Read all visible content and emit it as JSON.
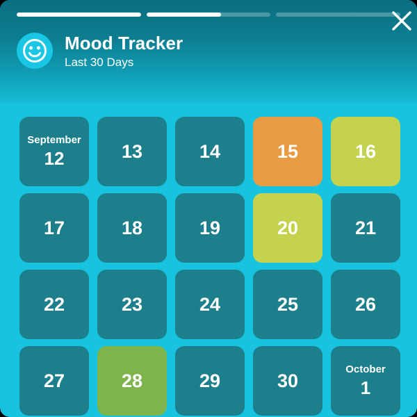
{
  "header": {
    "title": "Mood Tracker",
    "subtitle": "Last 30 Days",
    "icon": "smiley-face-icon",
    "close_icon": "close-x-icon",
    "progress": [
      {
        "label": "step-1",
        "percent": 100
      },
      {
        "label": "step-2",
        "percent": 60
      },
      {
        "label": "step-3",
        "percent": 0
      }
    ]
  },
  "colors": {
    "background": "#17C3DE",
    "header_top": "#0A6F80",
    "header_bottom": "#16BDD6",
    "cell_default": "#1E7F8C",
    "mood_orange": "#E89B42",
    "mood_yellow": "#C4D24E",
    "mood_green": "#7FB44C",
    "accent": "#19C6E4"
  },
  "calendar": {
    "days": [
      {
        "month": "September",
        "day": "12",
        "mood": "default"
      },
      {
        "month": "",
        "day": "13",
        "mood": "default"
      },
      {
        "month": "",
        "day": "14",
        "mood": "default"
      },
      {
        "month": "",
        "day": "15",
        "mood": "orange"
      },
      {
        "month": "",
        "day": "16",
        "mood": "yellow"
      },
      {
        "month": "",
        "day": "17",
        "mood": "default"
      },
      {
        "month": "",
        "day": "18",
        "mood": "default"
      },
      {
        "month": "",
        "day": "19",
        "mood": "default"
      },
      {
        "month": "",
        "day": "20",
        "mood": "yellow"
      },
      {
        "month": "",
        "day": "21",
        "mood": "default"
      },
      {
        "month": "",
        "day": "22",
        "mood": "default"
      },
      {
        "month": "",
        "day": "23",
        "mood": "default"
      },
      {
        "month": "",
        "day": "24",
        "mood": "default"
      },
      {
        "month": "",
        "day": "25",
        "mood": "default"
      },
      {
        "month": "",
        "day": "26",
        "mood": "default"
      },
      {
        "month": "",
        "day": "27",
        "mood": "default"
      },
      {
        "month": "",
        "day": "28",
        "mood": "green"
      },
      {
        "month": "",
        "day": "29",
        "mood": "default"
      },
      {
        "month": "",
        "day": "30",
        "mood": "default"
      },
      {
        "month": "October",
        "day": "1",
        "mood": "default"
      }
    ]
  }
}
